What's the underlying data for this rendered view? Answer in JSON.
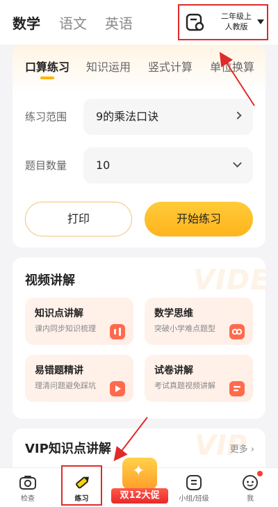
{
  "subjects": [
    {
      "label": "数学",
      "active": true
    },
    {
      "label": "语文",
      "active": false
    },
    {
      "label": "英语",
      "active": false
    }
  ],
  "grade_selector": {
    "line1": "二年级上",
    "line2": "人教版",
    "icon": "scan-icon"
  },
  "practice": {
    "tabs": [
      {
        "label": "口算练习",
        "active": true
      },
      {
        "label": "知识运用",
        "active": false
      },
      {
        "label": "竖式计算",
        "active": false
      },
      {
        "label": "单位换算",
        "active": false
      }
    ],
    "range_label": "练习范围",
    "range_value": "9的乘法口诀",
    "count_label": "题目数量",
    "count_value": "10",
    "print_button": "打印",
    "start_button": "开始练习"
  },
  "video_section": {
    "title": "视频讲解",
    "watermark": "VIDE",
    "tiles": [
      {
        "title": "知识点讲解",
        "subtitle": "课内同步知识梳理"
      },
      {
        "title": "数学思维",
        "subtitle": "突破小学难点题型"
      },
      {
        "title": "易错题精讲",
        "subtitle": "理清问题避免踩坑"
      },
      {
        "title": "试卷讲解",
        "subtitle": "考试真题视频讲解"
      }
    ]
  },
  "vip_section": {
    "title": "VIP知识点讲解",
    "more": "更多 ›",
    "watermark": "VIP"
  },
  "bottom_nav": {
    "items": [
      {
        "label": "检查",
        "icon": "camera-icon"
      },
      {
        "label": "练习",
        "icon": "pencil-icon",
        "active": true
      },
      {
        "label": "双12大促",
        "icon": "gift-promo-icon"
      },
      {
        "label": "小组/班级",
        "icon": "group-icon"
      },
      {
        "label": "我",
        "icon": "face-icon"
      }
    ]
  },
  "colors": {
    "accent": "#ffb400",
    "highlight": "#e02a2a",
    "promo": "#e8282a"
  }
}
